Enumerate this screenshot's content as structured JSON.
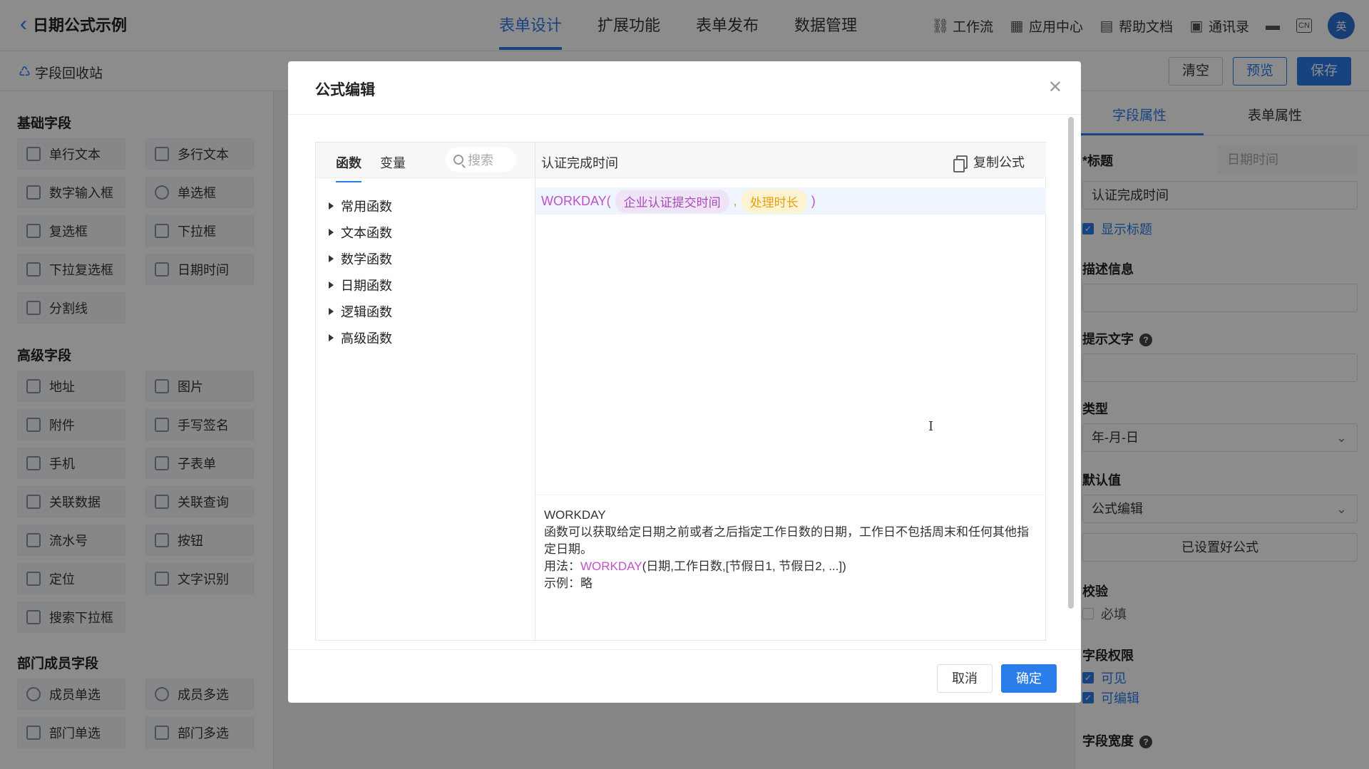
{
  "app": {
    "title": "日期公式示例",
    "nav": [
      "表单设计",
      "扩展功能",
      "表单发布",
      "数据管理"
    ],
    "tools": [
      {
        "label": "工作流",
        "icon": "workflow-icon"
      },
      {
        "label": "应用中心",
        "icon": "apps-icon"
      },
      {
        "label": "帮助文档",
        "icon": "doc-icon"
      },
      {
        "label": "通讯录",
        "icon": "contacts-icon"
      }
    ],
    "lang_badge": "CN",
    "avatar_text": "英"
  },
  "subbar": {
    "recycle_label": "字段回收站",
    "clear_label": "清空",
    "preview_label": "预览",
    "save_label": "保存"
  },
  "left_panel": {
    "basic_title": "基础字段",
    "basic": [
      "单行文本",
      "多行文本",
      "数字输入框",
      "单选框",
      "复选框",
      "下拉框",
      "下拉复选框",
      "日期时间",
      "分割线"
    ],
    "advanced_title": "高级字段",
    "advanced": [
      "地址",
      "图片",
      "附件",
      "手写签名",
      "手机",
      "子表单",
      "关联数据",
      "关联查询",
      "流水号",
      "按钮",
      "定位",
      "文字识别",
      "搜索下拉框"
    ],
    "dept_title": "部门成员字段",
    "dept": [
      "成员单选",
      "成员多选",
      "部门单选",
      "部门多选"
    ]
  },
  "right_panel": {
    "tab_field": "字段属性",
    "tab_form": "表单属性",
    "title_label": "*标题",
    "title_type_placeholder": "日期时间",
    "title_value": "认证完成时间",
    "show_title": "显示标题",
    "desc_label": "描述信息",
    "hint_label": "提示文字",
    "type_label": "类型",
    "type_value": "年-月-日",
    "default_label": "默认值",
    "default_value": "公式编辑",
    "formula_set": "已设置好公式",
    "validate_label": "校验",
    "required": "必填",
    "perm_label": "字段权限",
    "visible": "可见",
    "editable": "可编辑",
    "width_label": "字段宽度"
  },
  "modal": {
    "title": "公式编辑",
    "tab_functions": "函数",
    "tab_variables": "变量",
    "search_placeholder": "搜索",
    "function_groups": [
      "常用函数",
      "文本函数",
      "数学函数",
      "日期函数",
      "逻辑函数",
      "高级函数"
    ],
    "field_name": "认证完成时间",
    "copy_label": "复制公式",
    "formula": {
      "func_open": "WORKDAY(",
      "arg1": "企业认证提交时间",
      "sep": ",",
      "arg2": "处理时长",
      "close": ")"
    },
    "help": {
      "name": "WORKDAY",
      "desc": "函数可以获取给定日期之前或者之后指定工作日数的日期，工作日不包括周末和任何其他指定日期。",
      "usage_prefix": "用法：",
      "usage_func": "WORKDAY",
      "usage_args": "(日期,工作日数,[节假日1, 节假日2, ...])",
      "example": "示例：略"
    },
    "cancel_label": "取消",
    "ok_label": "确定"
  },
  "colors": {
    "accent": "#2b7de9",
    "func_purple": "#c150c9",
    "var_yellow": "#e3a013"
  }
}
